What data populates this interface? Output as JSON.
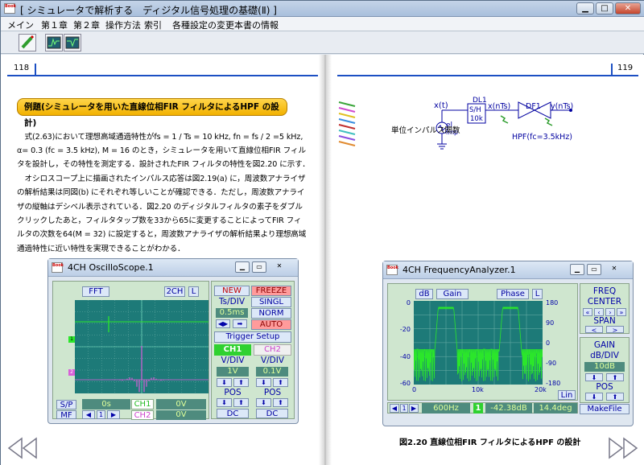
{
  "window": {
    "title": "[ シミュレータで解析する　ディジタル信号処理の基礎(Ⅱ) ]",
    "app_icon": "Book"
  },
  "menu": [
    "メイン",
    "第１章",
    "第２章",
    "操作方法",
    "索引",
    "各種設定の変更",
    "本書の情報"
  ],
  "left_page": {
    "page_number": "118",
    "example_title": "例題(シミュレータを用いた直線位相FIR フィルタによるHPF の設計)",
    "paragraph": [
      "　式(2.63)において理想高域通過特性がfs = 1 / Ts = 10 kHz, fn = fs / 2 =5 kHz,",
      "α= 0.3 (fc = 3.5 kHz), M = 16 のとき，シミュレータを用いて直線位相FIR フィル",
      "タを設計し，その特性を測定する．設計されたFIR フィルタの特性を図2.20 に示す．",
      "　オシロスコープ上に描画されたインパルス応答は図2.19(a) に，周波数アナライザ",
      "の解析結果は同図(b) にそれぞれ等しいことが確認できる．ただし，周波数アナライ",
      "ザの縦軸はデシベル表示されている．図2.20 のディジタルフィルタの素子をダブル",
      "クリックしたあと，フィルタタップ数を33から65に変更することによってFIR フィ",
      "ルタの次数を64(M = 32) に設定すると，周波数アナライザの解析結果より理想高域",
      "通過特性に近い特性を実現できることがわかる．"
    ]
  },
  "right_page": {
    "page_number": "119",
    "caption": "図2.20 直線位相FIR フィルタによるHPF の設計"
  },
  "circuit": {
    "input_label": "単位インパルス関数",
    "x_t": "x(t)",
    "source": "el",
    "source_sub": "imp",
    "dl1_name": "DL1",
    "dl1_line1": "S/H",
    "dl1_line2": "10k",
    "x_nts": "x(nTs)",
    "df1": "DF1",
    "y_nts": "y(nTs)",
    "hpf": "HPF(fc=3.5kHz)"
  },
  "oscilloscope": {
    "title": "4CH OscilloScope.1",
    "fft": "FFT",
    "ch_count": "2CH",
    "l": "L",
    "new": "NEW",
    "freeze": "FREEZE",
    "ts_div_label": "Ts/DIV",
    "ts_div_value": "0.5ms",
    "singl": "SINGL",
    "norm": "NORM",
    "auto": "AUTO",
    "trigger_setup": "Trigger Setup",
    "ch1": "CH1",
    "ch2": "CH2",
    "vdiv": "V/DIV",
    "ch1_vdiv": "1V",
    "ch2_vdiv": "0.1V",
    "pos": "POS",
    "dc": "DC",
    "sp": "S/P",
    "mf": "MF",
    "time_value": "0s",
    "ch1_value": "0V",
    "ch2_value": "0V",
    "page": "1"
  },
  "analyzer": {
    "title": "4CH FrequencyAnalyzer.1",
    "db": "dB",
    "gain": "Gain",
    "phase": "Phase",
    "l": "L",
    "y_left": [
      "0",
      "-20",
      "-40",
      "-60"
    ],
    "y_right": [
      "180",
      "90",
      "0",
      "-90",
      "-180"
    ],
    "x_ticks": [
      "0",
      "10k",
      "20k"
    ],
    "freq": "FREQ",
    "center": "CENTER",
    "span": "SPAN",
    "gain_label": "GAIN",
    "db_div": "dB/DIV",
    "db_div_value": "10dB",
    "pos": "POS",
    "lin": "Lin",
    "makefile": "MakeFile",
    "status_freq": "600Hz",
    "status_ch": "1",
    "status_gain": "-42.38dB",
    "status_phase": "14.4deg",
    "page": "1"
  },
  "colors": {
    "trace_green": "#2be62b",
    "trace_magenta": "#d85fd8",
    "screen": "#1d7a78",
    "page_rule": "#1c4fc3"
  },
  "icons": [
    "pen-icon",
    "oscilloscope-icon",
    "analyzer-icon",
    "prev-page-icon",
    "next-page-icon"
  ]
}
